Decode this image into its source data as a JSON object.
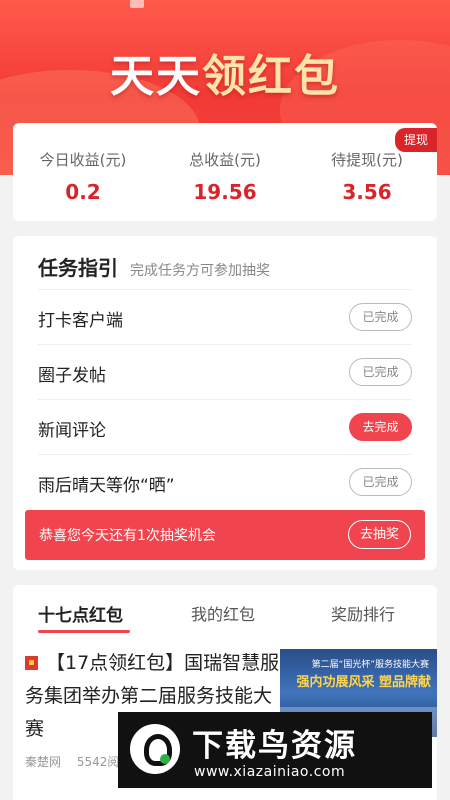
{
  "banner": {
    "title_part1": "天天",
    "title_part2": "领红包",
    "colors": {
      "primary": "#f23a36",
      "accent_text": "#ffe3a8"
    }
  },
  "earnings": {
    "withdraw_badge": "提现",
    "items": [
      {
        "label": "今日收益(元)",
        "value": "0.2"
      },
      {
        "label": "总收益(元)",
        "value": "19.56"
      },
      {
        "label": "待提现(元)",
        "value": "3.56"
      }
    ]
  },
  "tasks": {
    "title": "任务指引",
    "subtitle": "完成任务方可参加抽奖",
    "items": [
      {
        "name": "打卡客户端",
        "status": "已完成",
        "active": false
      },
      {
        "name": "圈子发帖",
        "status": "已完成",
        "active": false
      },
      {
        "name": "新闻评论",
        "status": "去完成",
        "active": true
      },
      {
        "name": "雨后晴天等你“晒”",
        "status": "已完成",
        "active": false
      }
    ],
    "lottery": {
      "text": "恭喜您今天还有1次抽奖机会",
      "button": "去抽奖"
    }
  },
  "news": {
    "tabs": [
      "十七点红包",
      "我的红包",
      "奖励排行"
    ],
    "active_tab": 0,
    "article": {
      "title": "【17点领红包】国瑞智慧服务集团举办第二届服务技能大赛",
      "source": "秦楚网",
      "reads": "5542阅",
      "thumb_line1": "第二届“国光杯”服务技能大赛",
      "thumb_line2": "强内功展风采 塑品牌献"
    }
  },
  "watermark": {
    "title": "下载鸟资源",
    "url": "www.xiazainiao.com"
  }
}
